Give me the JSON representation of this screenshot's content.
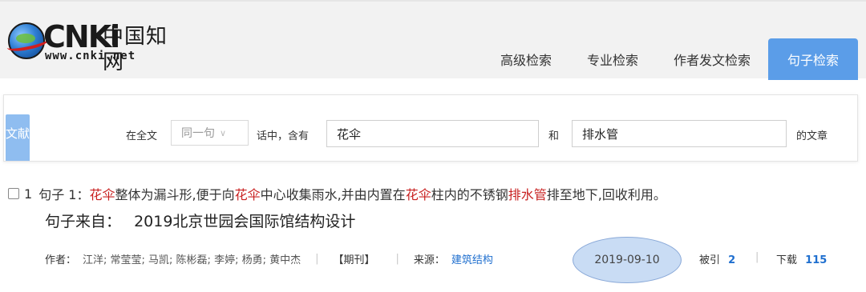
{
  "logo": {
    "wordmark": "CNKi",
    "cn_name": "中国知网",
    "url": "www.cnki.net"
  },
  "nav": {
    "tabs": [
      {
        "label": "高级检索",
        "active": false
      },
      {
        "label": "专业检索",
        "active": false
      },
      {
        "label": "作者发文检索",
        "active": false
      },
      {
        "label": "句子检索",
        "active": true
      }
    ]
  },
  "search": {
    "side_tab": "文献",
    "prefix": "在全文",
    "scope_select": "同一句",
    "middle": "话中，含有",
    "term1": "花伞",
    "conjunction": "和",
    "term2": "排水管",
    "suffix": "的文章"
  },
  "result": {
    "number": "1",
    "sentence_label": "句子 1：",
    "sentence_parts": [
      {
        "text": "花伞",
        "highlight": true
      },
      {
        "text": "整体为漏斗形,便于向",
        "highlight": false
      },
      {
        "text": "花伞",
        "highlight": true
      },
      {
        "text": "中心收集雨水,并由内置在",
        "highlight": false
      },
      {
        "text": "花伞",
        "highlight": true
      },
      {
        "text": "柱内的不锈钢",
        "highlight": false
      },
      {
        "text": "排水管",
        "highlight": true
      },
      {
        "text": "排至地下,回收利用。",
        "highlight": false
      }
    ],
    "source_label": "句子来自：",
    "source_title": "2019北京世园会国际馆结构设计",
    "authors_label": "作者：",
    "authors": "江洋; 常莹莹; 马凯; 陈彬磊; 李婷; 杨勇; 黄中杰",
    "type": "【期刊】",
    "origin_label": "来源：",
    "origin": "建筑结构",
    "date": "2019-09-10",
    "cited_label": "被引",
    "cited": "2",
    "download_label": "下载",
    "downloads": "115"
  },
  "colors": {
    "highlight": "#c81f1f",
    "active_tab": "#5b9de8",
    "link": "#1f6fcf",
    "date_oval": "#c9dcf4"
  }
}
